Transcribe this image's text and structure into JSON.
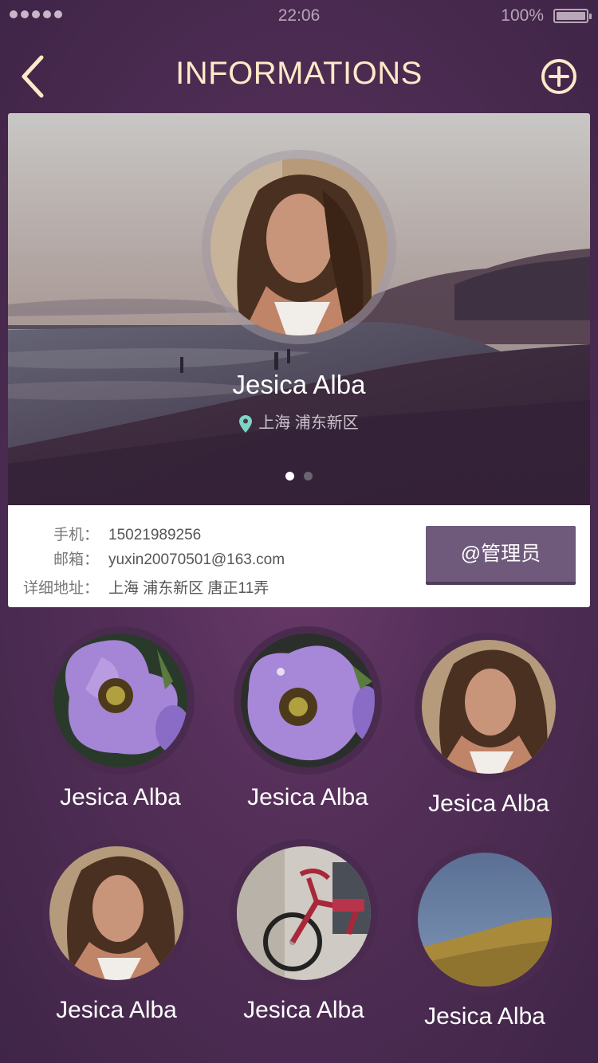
{
  "status_bar": {
    "time": "22:06",
    "battery": "100%"
  },
  "nav": {
    "title": "INFORMATIONS"
  },
  "profile": {
    "name": "Jesica Alba",
    "location": "上海 浦东新区",
    "carousel_total": 2,
    "carousel_active": 1
  },
  "info": {
    "phone_label": "手机：",
    "phone": "15021989256",
    "email_label": "邮箱：",
    "email": "yuxin20070501@163.com",
    "address_label": "详细地址：",
    "address": "上海 浦东新区 唐正11弄",
    "admin_button": "@管理员"
  },
  "contacts": [
    {
      "name": "Jesica Alba",
      "image": "purple-flower"
    },
    {
      "name": "Jesica Alba",
      "image": "purple-flower"
    },
    {
      "name": "Jesica Alba",
      "image": "woman-portrait"
    },
    {
      "name": "Jesica Alba",
      "image": "woman-portrait"
    },
    {
      "name": "Jesica Alba",
      "image": "red-bicycle"
    },
    {
      "name": "Jesica Alba",
      "image": "grass-hill"
    }
  ],
  "colors": {
    "title": "#ffe9c7",
    "background": "#56305a",
    "admin_button": "#6f5a7c",
    "pin": "#7fd4c6"
  }
}
